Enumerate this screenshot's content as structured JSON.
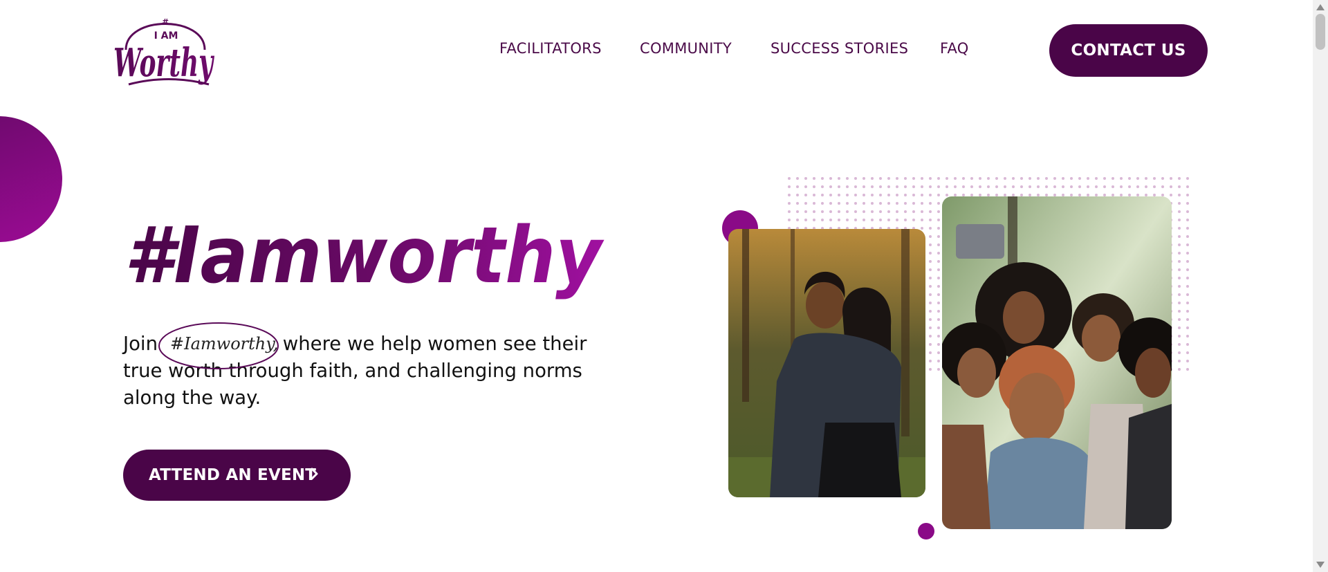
{
  "header": {
    "logo": {
      "line1": "#",
      "line2": "I AM",
      "line3": "Worthy"
    },
    "nav": [
      "FACILITATORS",
      "COMMUNITY",
      "SUCCESS STORIES",
      "FAQ"
    ],
    "contact_label": "CONTACT US"
  },
  "hero": {
    "title": "#Iamworthy",
    "text_before": "Join",
    "hashtag": "#Iamworthy,",
    "text_after": " where we help women see their true worth through faith, and challenging norms along the way.",
    "cta_label": "ATTEND AN EVENT"
  },
  "colors": {
    "brand_dark": "#4a0548",
    "brand_accent": "#8a0a87",
    "nav_text": "#4a0a48"
  },
  "icons": {
    "cta_icon": "chevron-right-icon",
    "image1": "two-women-photo",
    "image2": "group-selfie-photo"
  }
}
